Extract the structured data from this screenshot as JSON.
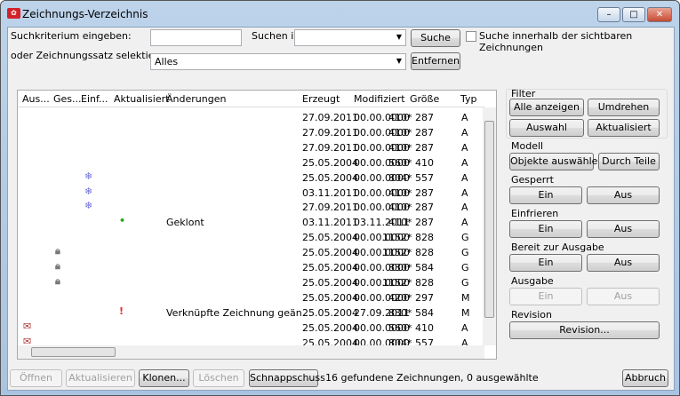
{
  "window": {
    "title": "Zeichnungs-Verzeichnis",
    "minimize": "–",
    "maximize": "□",
    "close": "✕"
  },
  "search": {
    "label": "Suchkriterium eingeben:",
    "value": "",
    "search_in_label": "Suchen in",
    "search_in_value": "",
    "search_button": "Suche",
    "visible_only_label": "Suche innerhalb der sichtbaren Zeichnungen",
    "visible_only_checked": false,
    "set_label": "oder Zeichnungssatz selektieren",
    "set_value": "Alles",
    "remove_button": "Entfernen"
  },
  "table": {
    "columns": [
      "Aus...",
      "Ges...",
      "Einf...",
      "Aktualisiert",
      "Änderungen",
      "Erzeugt",
      "Modifiziert",
      "Größe",
      "Typ"
    ],
    "rows": [
      {
        "icons": "",
        "change": "",
        "created": "27.09.2011",
        "modified": "00.00.0000",
        "size": "410* 287",
        "type": "A"
      },
      {
        "icons": "",
        "change": "",
        "created": "27.09.2011",
        "modified": "00.00.0000",
        "size": "410* 287",
        "type": "A"
      },
      {
        "icons": "",
        "change": "",
        "created": "27.09.2011",
        "modified": "00.00.0000",
        "size": "410* 287",
        "type": "A"
      },
      {
        "icons": "",
        "change": "",
        "created": "25.05.2004",
        "modified": "00.00.0000",
        "size": "560* 410",
        "type": "A"
      },
      {
        "icons": "freeze",
        "change": "",
        "created": "25.05.2004",
        "modified": "00.00.0000",
        "size": "804* 557",
        "type": "A"
      },
      {
        "icons": "freeze",
        "change": "",
        "created": "03.11.2011",
        "modified": "00.00.0000",
        "size": "410* 287",
        "type": "A"
      },
      {
        "icons": "freeze",
        "change": "",
        "created": "27.09.2011",
        "modified": "00.00.0000",
        "size": "410* 287",
        "type": "A"
      },
      {
        "icons": "updated-ok",
        "change": "Geklont",
        "created": "03.11.2011",
        "modified": "03.11.2011",
        "size": "410* 287",
        "type": "A"
      },
      {
        "icons": "",
        "change": "",
        "created": "25.05.2004",
        "modified": "00.00.0000",
        "size": "1152* 828",
        "type": "G"
      },
      {
        "icons": "lock",
        "change": "",
        "created": "25.05.2004",
        "modified": "00.00.0000",
        "size": "1152* 828",
        "type": "G"
      },
      {
        "icons": "lock",
        "change": "",
        "created": "25.05.2004",
        "modified": "00.00.0000",
        "size": "830* 584",
        "type": "G"
      },
      {
        "icons": "lock",
        "change": "",
        "created": "25.05.2004",
        "modified": "00.00.0000",
        "size": "1152* 828",
        "type": "G"
      },
      {
        "icons": "",
        "change": "",
        "created": "25.05.2004",
        "modified": "00.00.0000",
        "size": "420* 297",
        "type": "M"
      },
      {
        "icons": "updated-warn",
        "change": "Verknüpfte Zeichnung geän...",
        "created": "25.05.2004",
        "modified": "27.09.2011",
        "size": "830* 584",
        "type": "M"
      },
      {
        "icons": "issue",
        "change": "",
        "created": "25.05.2004",
        "modified": "00.00.0000",
        "size": "560* 410",
        "type": "A"
      },
      {
        "icons": "issue",
        "change": "",
        "created": "25.05.2004",
        "modified": "00.00.0000",
        "size": "804* 557",
        "type": "A"
      }
    ]
  },
  "panel": {
    "filter": {
      "label": "Filter",
      "show_all": "Alle anzeigen",
      "invert": "Umdrehen",
      "selection": "Auswahl",
      "updated": "Aktualisiert"
    },
    "model": {
      "label": "Modell",
      "select_objects": "Objekte auswählen",
      "by_parts": "Durch Teile"
    },
    "locked": {
      "label": "Gesperrt",
      "on": "Ein",
      "off": "Aus"
    },
    "freeze": {
      "label": "Einfrieren",
      "on": "Ein",
      "off": "Aus"
    },
    "ready": {
      "label": "Bereit zur Ausgabe",
      "on": "Ein",
      "off": "Aus"
    },
    "issue": {
      "label": "Ausgabe",
      "on": "Ein",
      "off": "Aus"
    },
    "revision": {
      "label": "Revision",
      "button": "Revision..."
    }
  },
  "footer": {
    "open": "Öffnen",
    "update": "Aktualisieren",
    "clone": "Klonen...",
    "delete": "Löschen",
    "snapshot": "Schnappschuss",
    "status": "16 gefundene Zeichnungen, 0 ausgewählte",
    "cancel": "Abbruch"
  }
}
